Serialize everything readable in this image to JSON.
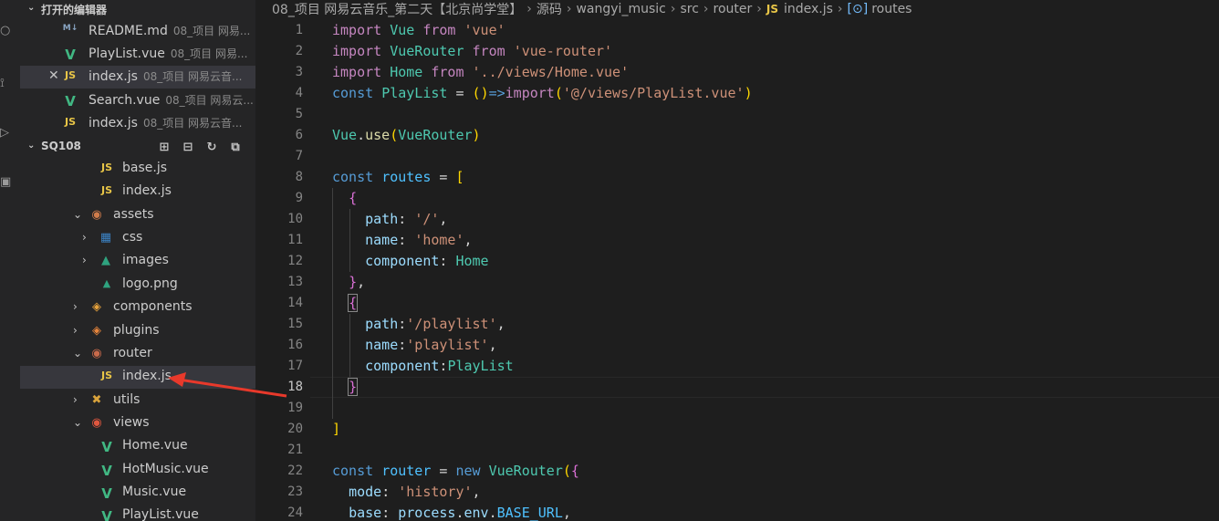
{
  "explorer": {
    "open_editors_title": "打开的编辑器",
    "open_editors": [
      {
        "icon": "M↓",
        "type": "md",
        "name": "README.md",
        "desc": "08_项目 网易..."
      },
      {
        "icon": "V",
        "type": "vue",
        "name": "PlayList.vue",
        "desc": "08_项目 网易..."
      },
      {
        "icon": "JS",
        "type": "js",
        "name": "index.js",
        "desc": "08_项目 网易云音...",
        "active": true,
        "close": "✕"
      },
      {
        "icon": "V",
        "type": "vue",
        "name": "Search.vue",
        "desc": "08_项目 网易云..."
      },
      {
        "icon": "JS",
        "type": "js",
        "name": "index.js",
        "desc": "08_项目 网易云音..."
      }
    ],
    "workspace_title": "SQ108",
    "tree": [
      {
        "icon": "JS",
        "type": "js",
        "name": "base.js"
      },
      {
        "icon": "JS",
        "type": "js",
        "name": "index.js"
      },
      {
        "chevron": "⌄",
        "type": "folder",
        "name": "assets"
      },
      {
        "chevron": "›",
        "type": "folder",
        "name": "css"
      },
      {
        "chevron": "›",
        "type": "folder",
        "name": "images"
      },
      {
        "icon": "▲",
        "type": "img",
        "name": "logo.png"
      },
      {
        "chevron": "›",
        "type": "folder",
        "name": "components"
      },
      {
        "chevron": "›",
        "type": "folder",
        "name": "plugins"
      },
      {
        "chevron": "⌄",
        "type": "folder",
        "name": "router"
      },
      {
        "icon": "JS",
        "type": "js",
        "name": "index.js",
        "selected": true
      },
      {
        "chevron": "›",
        "type": "folder",
        "name": "utils"
      },
      {
        "chevron": "⌄",
        "type": "folder",
        "name": "views"
      },
      {
        "icon": "V",
        "type": "vue",
        "name": "Home.vue"
      },
      {
        "icon": "V",
        "type": "vue",
        "name": "HotMusic.vue"
      },
      {
        "icon": "V",
        "type": "vue",
        "name": "Music.vue"
      },
      {
        "icon": "V",
        "type": "vue",
        "name": "PlayList.vue"
      }
    ]
  },
  "breadcrumb": {
    "parts": [
      "08_项目 网易云音乐_第二天【北京尚学堂】",
      "源码",
      "wangyi_music",
      "src",
      "router"
    ],
    "file_icon": "JS",
    "file": "index.js",
    "symbol_icon": "[⊙]",
    "symbol": "routes"
  },
  "editor": {
    "current_line": "18",
    "line_numbers": [
      "1",
      "2",
      "3",
      "4",
      "5",
      "6",
      "7",
      "8",
      "9",
      "10",
      "11",
      "12",
      "13",
      "14",
      "15",
      "16",
      "17",
      "18",
      "19",
      "20",
      "21",
      "22",
      "23",
      "24"
    ],
    "code": [
      "import Vue from 'vue'",
      "import VueRouter from 'vue-router'",
      "import Home from '../views/Home.vue'",
      "const PlayList = ()=>import('@/views/PlayList.vue')",
      "",
      "Vue.use(VueRouter)",
      "",
      "const routes = [",
      "  {",
      "    path: '/',",
      "    name: 'home',",
      "    component: Home",
      "  },",
      "  {",
      "    path:'/playlist',",
      "    name:'playlist',",
      "    component:PlayList",
      "  }",
      "",
      "]",
      "",
      "const router = new VueRouter({",
      "  mode: 'history',",
      "  base: process.env.BASE_URL,"
    ]
  },
  "colors": {
    "annotation_arrow": "#e8392b",
    "editor_bg": "#1e1e1e",
    "sidebar_bg": "#252526"
  }
}
